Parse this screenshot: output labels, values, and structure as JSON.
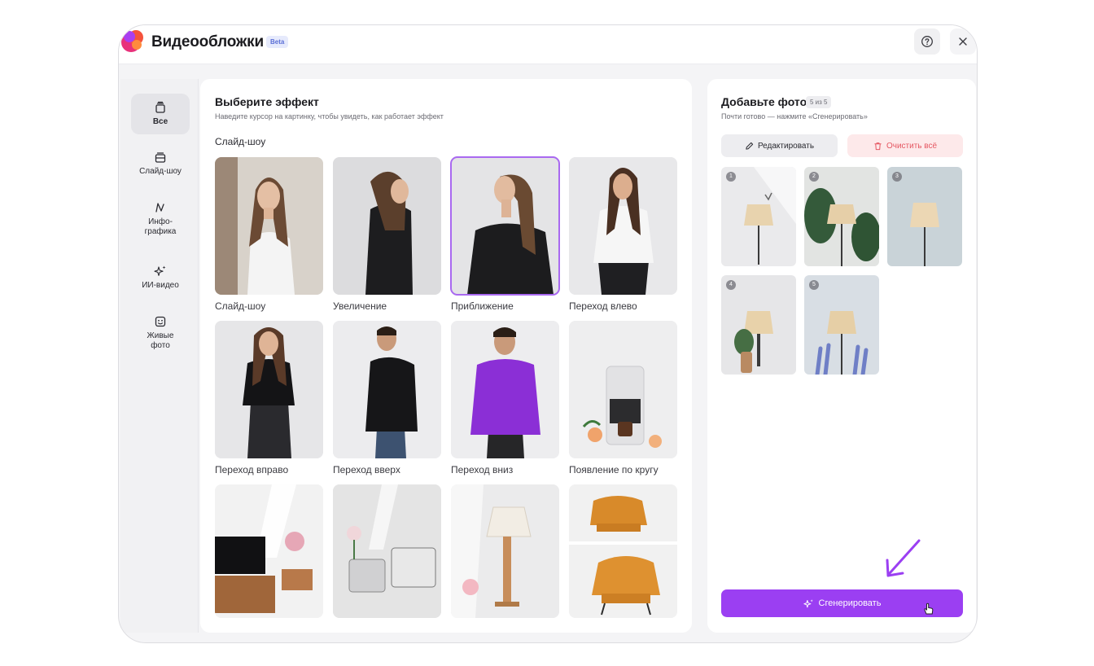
{
  "app": {
    "title": "Видеообложки",
    "badge": "Beta"
  },
  "sidebar": {
    "items": [
      {
        "label": "Все",
        "icon": "stack-icon",
        "active": true
      },
      {
        "label": "Слайд-шоу",
        "icon": "slides-icon"
      },
      {
        "label": "Инфо-графика",
        "icon": "chart-line-icon"
      },
      {
        "label": "ИИ-видео",
        "icon": "sparkles-icon"
      },
      {
        "label": "Живые фото",
        "icon": "smile-face-icon"
      }
    ]
  },
  "effects": {
    "title": "Выберите эффект",
    "subtitle": "Наведите курсор на картинку, чтобы увидеть, как работает эффект",
    "section": "Слайд-шоу",
    "tiles": [
      {
        "label": "Слайд-шоу"
      },
      {
        "label": "Увеличение"
      },
      {
        "label": "Приближение",
        "selected": true
      },
      {
        "label": "Переход влево"
      },
      {
        "label": "Переход вправо"
      },
      {
        "label": "Переход вверх"
      },
      {
        "label": "Переход вниз"
      },
      {
        "label": "Появление по кругу"
      },
      {
        "label": ""
      },
      {
        "label": ""
      },
      {
        "label": ""
      },
      {
        "label": ""
      }
    ]
  },
  "photos": {
    "title": "Добавьте фото",
    "count": "5 из 5",
    "subtitle": "Почти готово — нажмите «Сгенерировать»",
    "edit_label": "Редактировать",
    "clear_label": "Очистить всё",
    "items": [
      {
        "num": "1"
      },
      {
        "num": "2"
      },
      {
        "num": "3"
      },
      {
        "num": "4"
      },
      {
        "num": "5"
      }
    ],
    "generate_label": "Сгенерировать"
  },
  "colors": {
    "accent": "#9b3ff2",
    "selected_outline": "#a969f0",
    "danger": "#e55762",
    "badge": "#5b6fd6"
  }
}
